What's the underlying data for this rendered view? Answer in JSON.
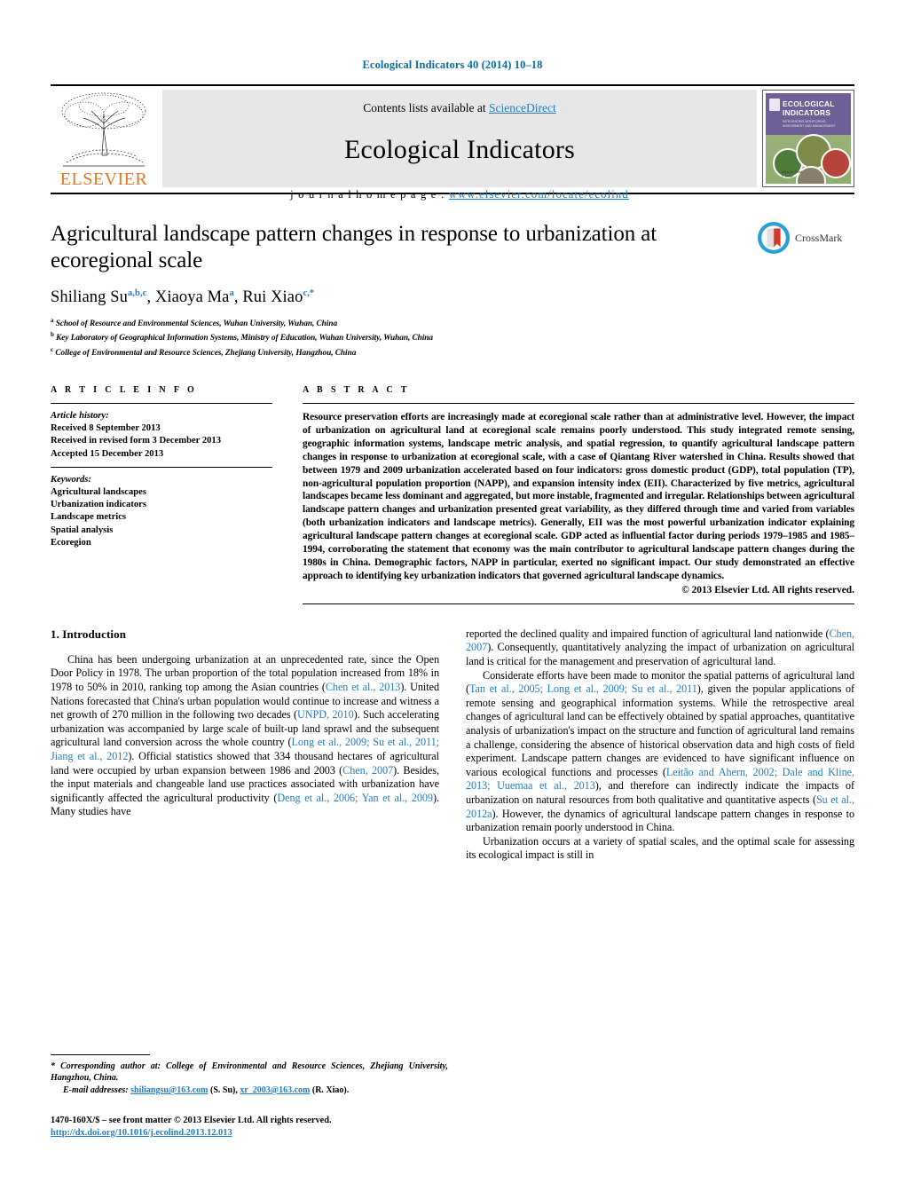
{
  "running_head": "Ecological Indicators 40 (2014) 10–18",
  "masthead": {
    "publisher_name": "ELSEVIER",
    "contents_prefix": "Contents lists available at ",
    "sciencedirect": "ScienceDirect",
    "journal_name": "Ecological Indicators",
    "homepage_label": "j o u r n a l   h o m e p a g e :   ",
    "homepage_url": "www.elsevier.com/locate/ecolind",
    "cover": {
      "title_line1": "ECOLOGICAL",
      "title_line2": "INDICATORS",
      "subtitle": "INTEGRATING MONITORING, ASSESSMENT AND MANAGEMENT",
      "footer_line1": "Editor-in-Chief",
      "footer_line2": "F. Müller"
    }
  },
  "article": {
    "title": "Agricultural landscape pattern changes in response to urbanization at ecoregional scale",
    "authors": [
      {
        "name": "Shiliang Su",
        "sup": "a,b,c",
        "sep": ", "
      },
      {
        "name": "Xiaoya Ma",
        "sup": "a",
        "sep": ", "
      },
      {
        "name": "Rui Xiao",
        "sup": "c,*",
        "sep": ""
      }
    ],
    "affiliations": [
      {
        "mark": "a",
        "text": "School of Resource and Environmental Sciences, Wuhan University, Wuhan, China"
      },
      {
        "mark": "b",
        "text": "Key Laboratory of Geographical Information Systems, Ministry of Education, Wuhan University, Wuhan, China"
      },
      {
        "mark": "c",
        "text": "College of Environmental and Resource Sciences, Zhejiang University, Hangzhou, China"
      }
    ],
    "crossmark_label": "CrossMark"
  },
  "article_info": {
    "heading": "A R T I C L E   I N F O",
    "history_heading": "Article history:",
    "history": [
      "Received 8 September 2013",
      "Received in revised form 3 December 2013",
      "Accepted 15 December 2013"
    ],
    "keywords_heading": "Keywords:",
    "keywords": [
      "Agricultural landscapes",
      "Urbanization indicators",
      "Landscape metrics",
      "Spatial analysis",
      "Ecoregion"
    ]
  },
  "abstract": {
    "heading": "A B S T R A C T",
    "text": "Resource preservation efforts are increasingly made at ecoregional scale rather than at administrative level. However, the impact of urbanization on agricultural land at ecoregional scale remains poorly understood. This study integrated remote sensing, geographic information systems, landscape metric analysis, and spatial regression, to quantify agricultural landscape pattern changes in response to urbanization at ecoregional scale, with a case of Qiantang River watershed in China. Results showed that between 1979 and 2009 urbanization accelerated based on four indicators: gross domestic product (GDP), total population (TP), non-agricultural population proportion (NAPP), and expansion intensity index (EII). Characterized by five metrics, agricultural landscapes became less dominant and aggregated, but more instable, fragmented and irregular. Relationships between agricultural landscape pattern changes and urbanization presented great variability, as they differed through time and varied from variables (both urbanization indicators and landscape metrics). Generally, EII was the most powerful urbanization indicator explaining agricultural landscape pattern changes at ecoregional scale. GDP acted as influential factor during periods 1979–1985 and 1985–1994, corroborating the statement that economy was the main contributor to agricultural landscape pattern changes during the 1980s in China. Demographic factors, NAPP in particular, exerted no significant impact. Our study demonstrated an effective approach to identifying key urbanization indicators that governed agricultural landscape dynamics.",
    "copyright": "© 2013 Elsevier Ltd. All rights reserved."
  },
  "introduction": {
    "heading": "1.  Introduction",
    "left_paragraphs": [
      {
        "runs": [
          {
            "t": "China has been undergoing urbanization at an unprecedented rate, since the Open Door Policy in 1978. The urban proportion of the total population increased from 18% in 1978 to 50% in 2010, ranking top among the Asian countries (",
            "link": false
          },
          {
            "t": "Chen et al., 2013",
            "link": true
          },
          {
            "t": "). United Nations forecasted that China's urban population would continue to increase and witness a net growth of 270 million in the following two decades (",
            "link": false
          },
          {
            "t": "UNPD, 2010",
            "link": true
          },
          {
            "t": "). Such accelerating urbanization was accompanied by large scale of built-up land sprawl and the subsequent agricultural land conversion across the whole country (",
            "link": false
          },
          {
            "t": "Long et al., 2009; Su et al., 2011; Jiang et al., 2012",
            "link": true
          },
          {
            "t": "). Official statistics showed that 334 thousand hectares of agricultural land were occupied by urban expansion between 1986 and 2003 (",
            "link": false
          },
          {
            "t": "Chen, 2007",
            "link": true
          },
          {
            "t": "). Besides, the input materials and changeable land use practices associated with urbanization have significantly affected the agricultural productivity (",
            "link": false
          },
          {
            "t": "Deng et al., 2006; Yan et al., 2009",
            "link": true
          },
          {
            "t": "). Many studies have",
            "link": false
          }
        ]
      }
    ],
    "right_paragraphs": [
      {
        "indent": false,
        "runs": [
          {
            "t": "reported the declined quality and impaired function of agricultural land nationwide (",
            "link": false
          },
          {
            "t": "Chen, 2007",
            "link": true
          },
          {
            "t": "). Consequently, quantitatively analyzing the impact of urbanization on agricultural land is critical for the management and preservation of agricultural land.",
            "link": false
          }
        ]
      },
      {
        "indent": true,
        "runs": [
          {
            "t": "Considerate efforts have been made to monitor the spatial patterns of agricultural land (",
            "link": false
          },
          {
            "t": "Tan et al., 2005; Long et al., 2009; Su et al., 2011",
            "link": true
          },
          {
            "t": "), given the popular applications of remote sensing and geographical information systems. While the retrospective areal changes of agricultural land can be effectively obtained by spatial approaches, quantitative analysis of urbanization's impact on the structure and function of agricultural land remains a challenge, considering the absence of historical observation data and high costs of field experiment. Landscape pattern changes are evidenced to have significant influence on various ecological functions and processes (",
            "link": false
          },
          {
            "t": "Leitão and Ahern, 2002; Dale and Kline, 2013; Uuemaa et al., 2013",
            "link": true
          },
          {
            "t": "), and therefore can indirectly indicate the impacts of urbanization on natural resources from both qualitative and quantitative aspects (",
            "link": false
          },
          {
            "t": "Su et al., 2012a",
            "link": true
          },
          {
            "t": "). However, the dynamics of agricultural landscape pattern changes in response to urbanization remain poorly understood in China.",
            "link": false
          }
        ]
      },
      {
        "indent": true,
        "runs": [
          {
            "t": "Urbanization occurs at a variety of spatial scales, and the optimal scale for assessing its ecological impact is still in",
            "link": false
          }
        ]
      }
    ]
  },
  "footnote": {
    "corresponding": "* Corresponding author at: College of Environmental and Resource Sciences, Zhejiang University, Hangzhou, China.",
    "email_label": "E-mail addresses:",
    "emails": [
      {
        "address": "shiliangsu@163.com",
        "owner": "(S. Su)",
        "sep": ", "
      },
      {
        "address": "xr_2003@163.com",
        "owner": "(R. Xiao).",
        "sep": ""
      }
    ]
  },
  "imprint": {
    "line1": "1470-160X/$ – see front matter © 2013 Elsevier Ltd. All rights reserved.",
    "doi": "http://dx.doi.org/10.1016/j.ecolind.2013.12.013"
  },
  "colors": {
    "link": "#1f7fc0",
    "runhead": "#0b6d9e",
    "elsevier_orange": "#e87722",
    "masthead_gray": "#e6e7e8"
  }
}
